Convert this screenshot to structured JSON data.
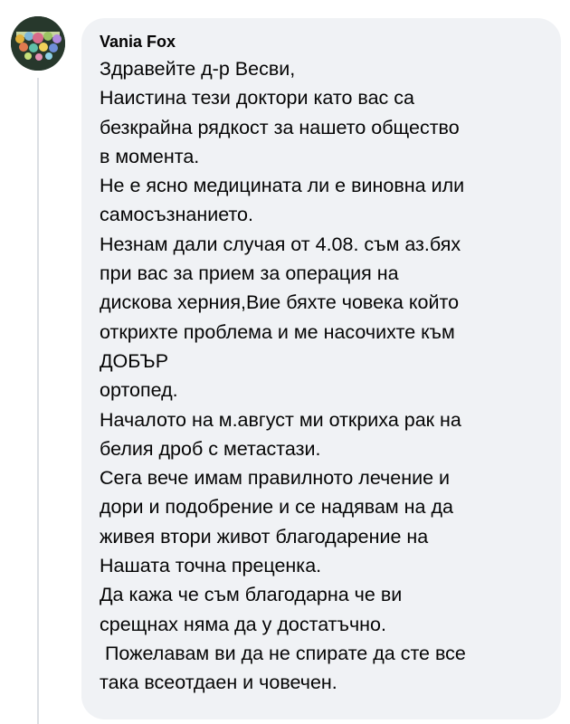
{
  "comment": {
    "author": "Vania Fox",
    "avatar_icon": "profile-picture-icon",
    "lines": [
      "Здравейте д-р Весви,",
      "Наистина тези доктори като вас са",
      "безкрайна рядкост за нашето общество",
      "в момента.",
      "Не е ясно медицината ли е виновна или",
      "самосъзнанието.",
      "Незнам дали случая от 4.08. съм аз.бях",
      "при вас за прием за операция на",
      "дискова херния,Вие бяхте човека който",
      "открихте проблема и ме насочихте към",
      "ДОБЪР",
      "ортопед.",
      "Началото на м.август ми откриха рак на",
      "белия дроб с метастази.",
      "Сега вече имам правилното лечение и",
      "дори и подобрение и се надявам на да",
      "живея втори живот благодарение на",
      "Нашата точна преценка.",
      "Да кажа че съм благодарна че ви",
      "срещнах няма да у достатъчно.",
      " Пожелавам ви да не спирате да сте все",
      "така всеотдаен и човечен."
    ]
  },
  "colors": {
    "bubble_background": "#f0f2f5",
    "text": "#050505",
    "thread_line": "#dcdfe3"
  }
}
